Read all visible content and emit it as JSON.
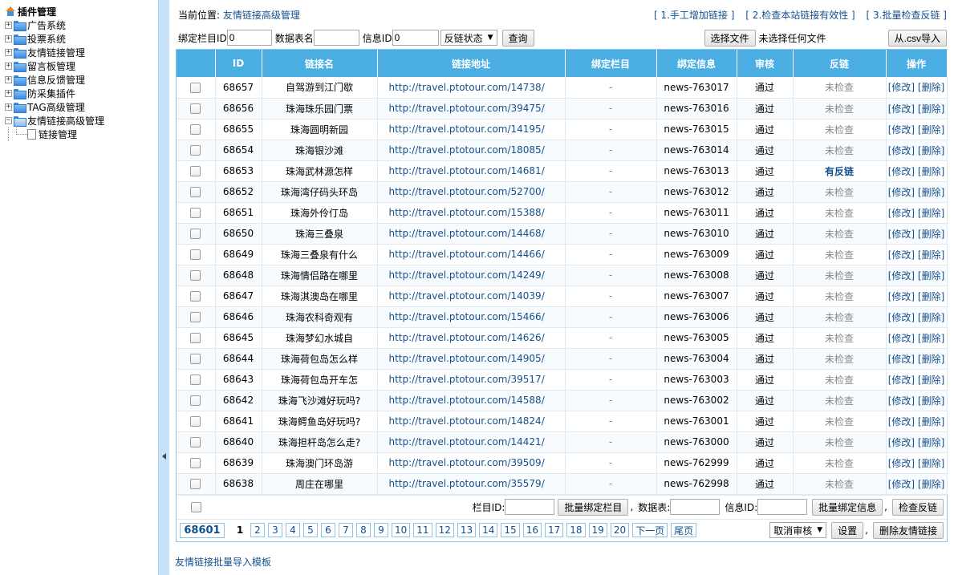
{
  "sidebar": {
    "root": "插件管理",
    "items": [
      {
        "label": "广告系统"
      },
      {
        "label": "投票系统"
      },
      {
        "label": "友情链接管理"
      },
      {
        "label": "留言板管理"
      },
      {
        "label": "信息反馈管理"
      },
      {
        "label": "防采集插件"
      },
      {
        "label": "TAG高级管理"
      },
      {
        "label": "友情链接高级管理"
      }
    ],
    "child": "链接管理"
  },
  "breadcrumb": {
    "label": "当前位置:",
    "link": "友情链接高级管理"
  },
  "toplinks": [
    "[ 1.手工增加链接 ]",
    "[ 2.检查本站链接有效性 ]",
    "[ 3.批量检查反链 ]"
  ],
  "filter": {
    "catid_label": "绑定栏目ID",
    "catid_value": "0",
    "table_label": "数据表名",
    "table_value": "",
    "infoid_label": "信息ID",
    "infoid_value": "0",
    "status_select": "反链状态",
    "query_btn": "查询",
    "choose_file_btn": "选择文件",
    "no_file": "未选择任何文件",
    "csv_btn": "从.csv导入"
  },
  "table": {
    "headers": [
      "ID",
      "链接名",
      "链接地址",
      "绑定栏目",
      "绑定信息",
      "审核",
      "反链",
      "操作"
    ],
    "rows": [
      {
        "id": "68657",
        "name": "自驾游到江门歇",
        "url": "http://travel.ptotour.com/14738/",
        "cat": "-",
        "info": "news-763017",
        "audit": "通过",
        "back": "未检查",
        "op": "[修改] [删除]"
      },
      {
        "id": "68656",
        "name": "珠海珠乐园门票",
        "url": "http://travel.ptotour.com/39475/",
        "cat": "-",
        "info": "news-763016",
        "audit": "通过",
        "back": "未检查",
        "op": "[修改] [删除]"
      },
      {
        "id": "68655",
        "name": "珠海圆明新园",
        "url": "http://travel.ptotour.com/14195/",
        "cat": "-",
        "info": "news-763015",
        "audit": "通过",
        "back": "未检查",
        "op": "[修改] [删除]"
      },
      {
        "id": "68654",
        "name": "珠海银沙滩",
        "url": "http://travel.ptotour.com/18085/",
        "cat": "-",
        "info": "news-763014",
        "audit": "通过",
        "back": "未检查",
        "op": "[修改] [删除]"
      },
      {
        "id": "68653",
        "name": "珠海武林源怎样",
        "url": "http://travel.ptotour.com/14681/",
        "cat": "-",
        "info": "news-763013",
        "audit": "通过",
        "back": "有反链",
        "op": "[修改] [删除]"
      },
      {
        "id": "68652",
        "name": "珠海湾仔码头环岛",
        "url": "http://travel.ptotour.com/52700/",
        "cat": "-",
        "info": "news-763012",
        "audit": "通过",
        "back": "未检查",
        "op": "[修改] [删除]"
      },
      {
        "id": "68651",
        "name": "珠海外伶仃岛",
        "url": "http://travel.ptotour.com/15388/",
        "cat": "-",
        "info": "news-763011",
        "audit": "通过",
        "back": "未检查",
        "op": "[修改] [删除]"
      },
      {
        "id": "68650",
        "name": "珠海三叠泉",
        "url": "http://travel.ptotour.com/14468/",
        "cat": "-",
        "info": "news-763010",
        "audit": "通过",
        "back": "未检查",
        "op": "[修改] [删除]"
      },
      {
        "id": "68649",
        "name": "珠海三叠泉有什么",
        "url": "http://travel.ptotour.com/14466/",
        "cat": "-",
        "info": "news-763009",
        "audit": "通过",
        "back": "未检查",
        "op": "[修改] [删除]"
      },
      {
        "id": "68648",
        "name": "珠海情侣路在哪里",
        "url": "http://travel.ptotour.com/14249/",
        "cat": "-",
        "info": "news-763008",
        "audit": "通过",
        "back": "未检查",
        "op": "[修改] [删除]"
      },
      {
        "id": "68647",
        "name": "珠海淇澳岛在哪里",
        "url": "http://travel.ptotour.com/14039/",
        "cat": "-",
        "info": "news-763007",
        "audit": "通过",
        "back": "未检查",
        "op": "[修改] [删除]"
      },
      {
        "id": "68646",
        "name": "珠海农科奇观有",
        "url": "http://travel.ptotour.com/15466/",
        "cat": "-",
        "info": "news-763006",
        "audit": "通过",
        "back": "未检查",
        "op": "[修改] [删除]"
      },
      {
        "id": "68645",
        "name": "珠海梦幻水城自",
        "url": "http://travel.ptotour.com/14626/",
        "cat": "-",
        "info": "news-763005",
        "audit": "通过",
        "back": "未检查",
        "op": "[修改] [删除]"
      },
      {
        "id": "68644",
        "name": "珠海荷包岛怎么样",
        "url": "http://travel.ptotour.com/14905/",
        "cat": "-",
        "info": "news-763004",
        "audit": "通过",
        "back": "未检查",
        "op": "[修改] [删除]"
      },
      {
        "id": "68643",
        "name": "珠海荷包岛开车怎",
        "url": "http://travel.ptotour.com/39517/",
        "cat": "-",
        "info": "news-763003",
        "audit": "通过",
        "back": "未检查",
        "op": "[修改] [删除]"
      },
      {
        "id": "68642",
        "name": "珠海飞沙滩好玩吗?",
        "url": "http://travel.ptotour.com/14588/",
        "cat": "-",
        "info": "news-763002",
        "audit": "通过",
        "back": "未检查",
        "op": "[修改] [删除]"
      },
      {
        "id": "68641",
        "name": "珠海鳄鱼岛好玩吗?",
        "url": "http://travel.ptotour.com/14824/",
        "cat": "-",
        "info": "news-763001",
        "audit": "通过",
        "back": "未检查",
        "op": "[修改] [删除]"
      },
      {
        "id": "68640",
        "name": "珠海担杆岛怎么走?",
        "url": "http://travel.ptotour.com/14421/",
        "cat": "-",
        "info": "news-763000",
        "audit": "通过",
        "back": "未检查",
        "op": "[修改] [删除]"
      },
      {
        "id": "68639",
        "name": "珠海澳门环岛游",
        "url": "http://travel.ptotour.com/39509/",
        "cat": "-",
        "info": "news-762999",
        "audit": "通过",
        "back": "未检查",
        "op": "[修改] [删除]"
      },
      {
        "id": "68638",
        "name": "周庄在哪里",
        "url": "http://travel.ptotour.com/35579/",
        "cat": "-",
        "info": "news-762998",
        "audit": "通过",
        "back": "未检查",
        "op": "[修改] [删除]"
      }
    ]
  },
  "batch": {
    "cat_label": "栏目ID:",
    "bind_cat_btn": "批量绑定栏目",
    "table_label": "数据表:",
    "info_label": "信息ID:",
    "bind_info_btn": "批量绑定信息",
    "check_back_btn": "检查反链"
  },
  "pager": {
    "total": "68601",
    "pages": [
      "1",
      "2",
      "3",
      "4",
      "5",
      "6",
      "7",
      "8",
      "9",
      "10",
      "11",
      "12",
      "13",
      "14",
      "15",
      "16",
      "17",
      "18",
      "19",
      "20"
    ],
    "next": "下一页",
    "last": "尾页",
    "audit_select": "取消审核",
    "set_btn": "设置",
    "delete_btn": "删除友情链接"
  },
  "footer_link": "友情链接批量导入模板",
  "colors": {
    "header_bg": "#4aaee3",
    "link": "#13508e",
    "splitter": "#c6e2f7"
  }
}
